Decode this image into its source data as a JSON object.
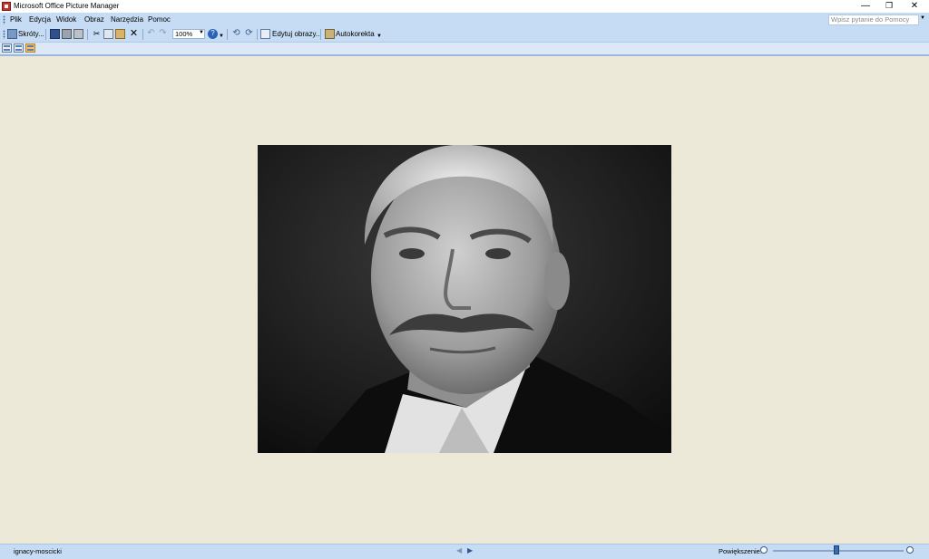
{
  "window": {
    "title": "Microsoft Office Picture Manager",
    "minimize": "—",
    "maximize": "❐",
    "close": "✕"
  },
  "menu": [
    "Plik",
    "Edycja",
    "Widok",
    "Obraz",
    "Narzędzia",
    "Pomoc"
  ],
  "help": {
    "placeholder": "Wpisz pytanie do Pomocy"
  },
  "toolbar": {
    "shortcuts_label": "Skróty...",
    "zoom_value": "100%",
    "edit_label": "Edytuj obrazy...",
    "autocorrect_label": "Autokorekta"
  },
  "status": {
    "filename": "ignacy-moscicki",
    "zoom_label": "Powiększenie:",
    "zoom_level_percent": 55
  },
  "colors": {
    "background": "#ece9d8",
    "bars": "#c6dcf4",
    "accent": "#f8c06a"
  }
}
